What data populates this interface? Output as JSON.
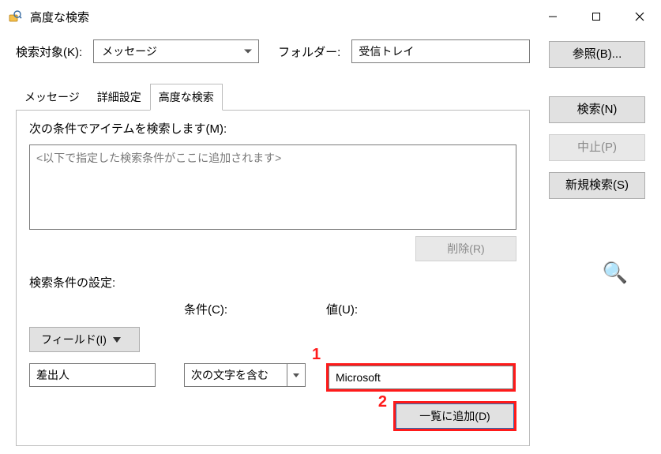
{
  "window": {
    "title": "高度な検索"
  },
  "top": {
    "searchTargetLabel": "検索対象(K):",
    "searchTargetValue": "メッセージ",
    "folderLabel": "フォルダー:",
    "folderValue": "受信トレイ"
  },
  "side": {
    "browse": "参照(B)...",
    "search": "検索(N)",
    "stop": "中止(P)",
    "newSearch": "新規検索(S)"
  },
  "tabs": {
    "messages": "メッセージ",
    "details": "詳細設定",
    "advanced": "高度な検索"
  },
  "panel": {
    "criteriaLabel": "次の条件でアイテムを検索します(M):",
    "criteriaPlaceholder": "<以下で指定した検索条件がここに追加されます>",
    "deleteBtn": "削除(R)",
    "settingsLabel": "検索条件の設定:",
    "fieldBtn": "フィールド(I)",
    "conditionLabel": "条件(C):",
    "conditionValue": "次の文字を含む",
    "valueLabel": "値(U):",
    "valueValue": "Microsoft",
    "addBtn": "一覧に追加(D)",
    "fromValue": "差出人"
  },
  "annotations": {
    "marker1": "1",
    "marker2": "2"
  },
  "icons": {
    "magnifier": "🔍"
  }
}
